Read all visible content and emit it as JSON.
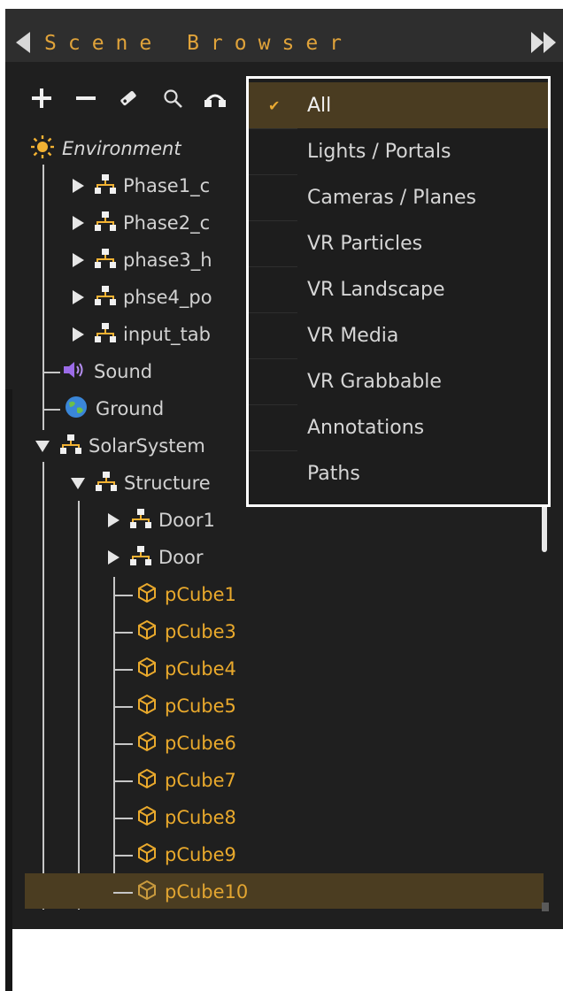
{
  "panel": {
    "title": "Scene Browser",
    "colors": {
      "background": "#1f1f1f",
      "accent": "#e0a33a",
      "selection": "#4b3d21"
    }
  },
  "toolbar": {
    "icons": [
      "add-icon",
      "remove-icon",
      "tag-icon",
      "search-icon",
      "filter-icon"
    ]
  },
  "tree": {
    "environment": {
      "label": "Environment",
      "icon": "sun-icon"
    },
    "phase_items": [
      {
        "label": "Phase1_c"
      },
      {
        "label": "Phase2_c"
      },
      {
        "label": "phase3_h"
      },
      {
        "label": "phse4_po"
      },
      {
        "label": "input_tab"
      }
    ],
    "sound": {
      "label": "Sound",
      "icon": "speaker-icon"
    },
    "ground": {
      "label": "Ground",
      "icon": "globe-icon"
    },
    "solar_system": {
      "label": "SolarSystem"
    },
    "structure": {
      "label": "Structure"
    },
    "doors": [
      {
        "label": "Door1"
      },
      {
        "label": "Door"
      }
    ],
    "meshes": [
      {
        "label": "pCube1"
      },
      {
        "label": "pCube3"
      },
      {
        "label": "pCube4"
      },
      {
        "label": "pCube5"
      },
      {
        "label": "pCube6"
      },
      {
        "label": "pCube7"
      },
      {
        "label": "pCube8"
      },
      {
        "label": "pCube9"
      },
      {
        "label": "pCube10",
        "selected": true
      }
    ]
  },
  "filter_menu": {
    "items": [
      {
        "label": "All",
        "checked": true
      },
      {
        "label": "Lights / Portals"
      },
      {
        "label": "Cameras / Planes"
      },
      {
        "label": "VR Particles"
      },
      {
        "label": "VR Landscape"
      },
      {
        "label": "VR Media"
      },
      {
        "label": "VR Grabbable"
      },
      {
        "label": "Annotations"
      },
      {
        "label": "Paths"
      }
    ],
    "check_glyph": "✔"
  }
}
